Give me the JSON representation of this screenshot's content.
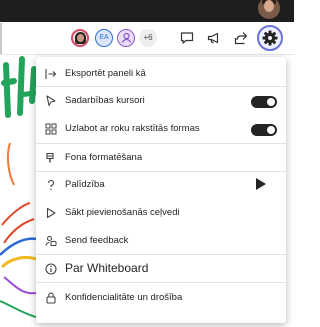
{
  "toolbar": {
    "initials_avatar": "EA",
    "more_count": "+6"
  },
  "menu": {
    "items": [
      {
        "label": "Eksportēt paneli kā",
        "icon": "export-icon"
      },
      {
        "label": "Sadarbības kursori",
        "icon": "cursor-icon",
        "toggle_on": true
      },
      {
        "label": "Uzlabot ar roku rakstītās formas",
        "icon": "shapes-icon",
        "toggle_on": true
      },
      {
        "label": "Fona formatēšana",
        "icon": "paint-bucket-icon"
      },
      {
        "label": "Palīdzība",
        "icon": "question-icon"
      },
      {
        "label": "Sākt pievienošanās ceļvedi",
        "icon": "play-icon"
      },
      {
        "label": "Send feedback",
        "icon": "feedback-icon"
      },
      {
        "label": "Par Whiteboard",
        "icon": "info-icon"
      },
      {
        "label": "Konfidencialitāte un drošība",
        "icon": "lock-icon"
      }
    ]
  },
  "colors": {
    "accent": "#6b72d6",
    "toggle": "#242424",
    "topbar": "#1e1e1e"
  }
}
